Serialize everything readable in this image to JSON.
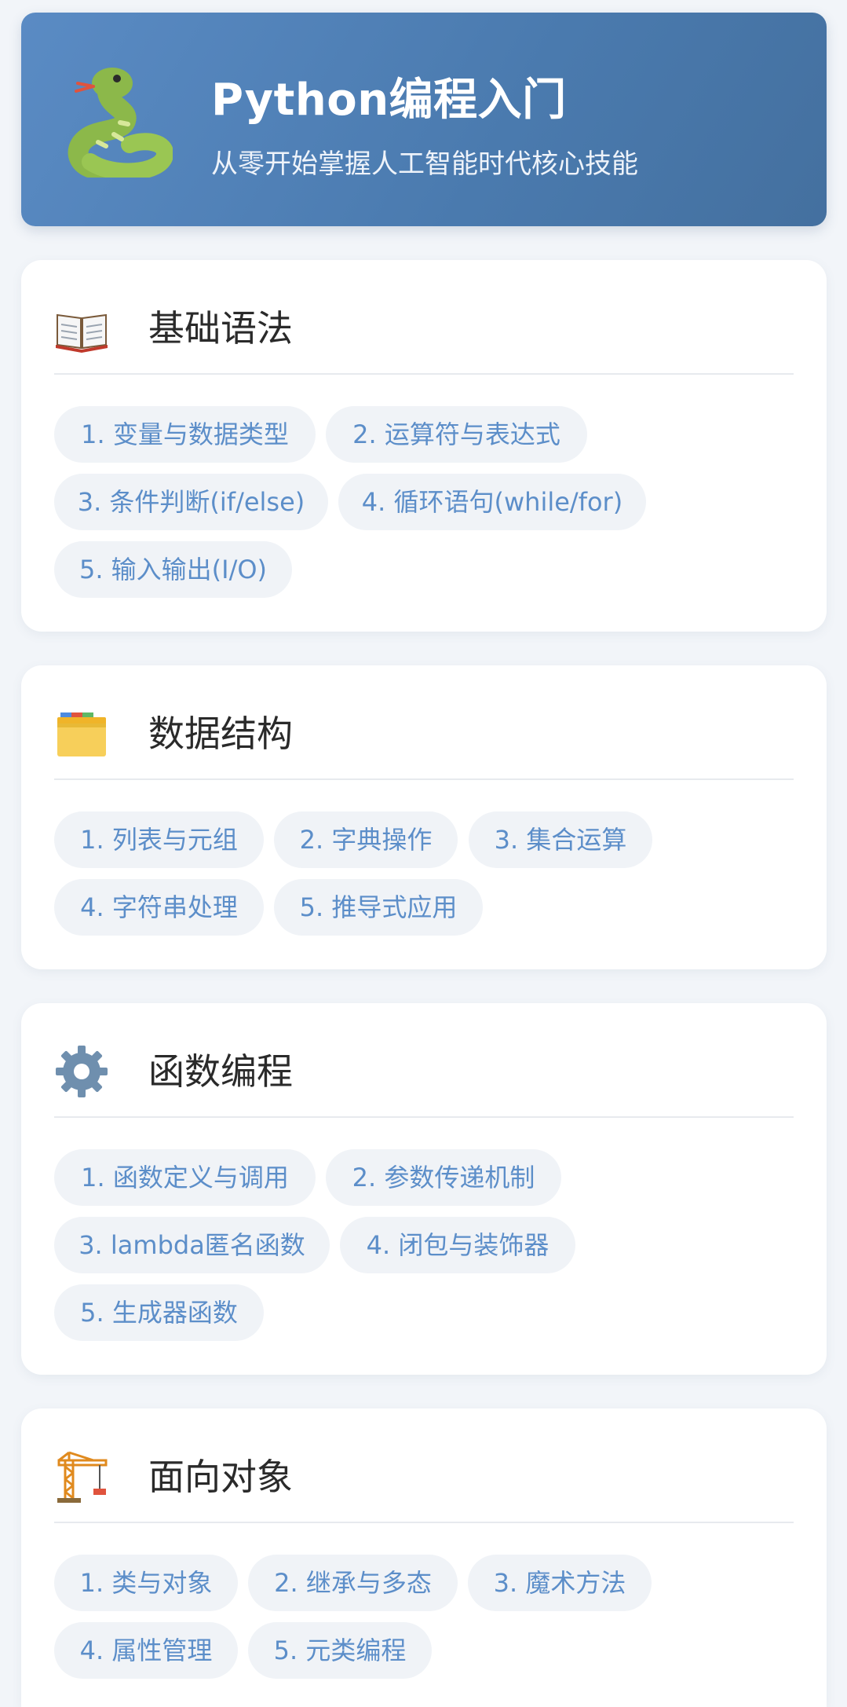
{
  "header": {
    "icon": "snake-icon",
    "title": "Python编程入门",
    "subtitle": "从零开始掌握人工智能时代核心技能"
  },
  "sections": [
    {
      "icon": "open-book-icon",
      "title": "基础语法",
      "topics": [
        "1. 变量与数据类型",
        "2. 运算符与表达式",
        "3. 条件判断(if/else)",
        "4. 循环语句(while/for)",
        "5. 输入输出(I/O)"
      ]
    },
    {
      "icon": "card-index-dividers-icon",
      "title": "数据结构",
      "topics": [
        "1. 列表与元组",
        "2. 字典操作",
        "3. 集合运算",
        "4. 字符串处理",
        "5. 推导式应用"
      ]
    },
    {
      "icon": "gear-icon",
      "title": "函数编程",
      "topics": [
        "1. 函数定义与调用",
        "2. 参数传递机制",
        "3. lambda匿名函数",
        "4. 闭包与装饰器",
        "5. 生成器函数"
      ]
    },
    {
      "icon": "construction-crane-icon",
      "title": "面向对象",
      "topics": [
        "1. 类与对象",
        "2. 继承与多态",
        "3. 魔术方法",
        "4. 属性管理",
        "5. 元类编程"
      ]
    }
  ],
  "colors": {
    "header_gradient_start": "#5a8bc4",
    "header_gradient_end": "#44709f",
    "page_background": "#f2f5f9",
    "pill_background": "#f0f3f7",
    "pill_text": "#5c8ec9",
    "card_title": "#2a2a2a"
  }
}
